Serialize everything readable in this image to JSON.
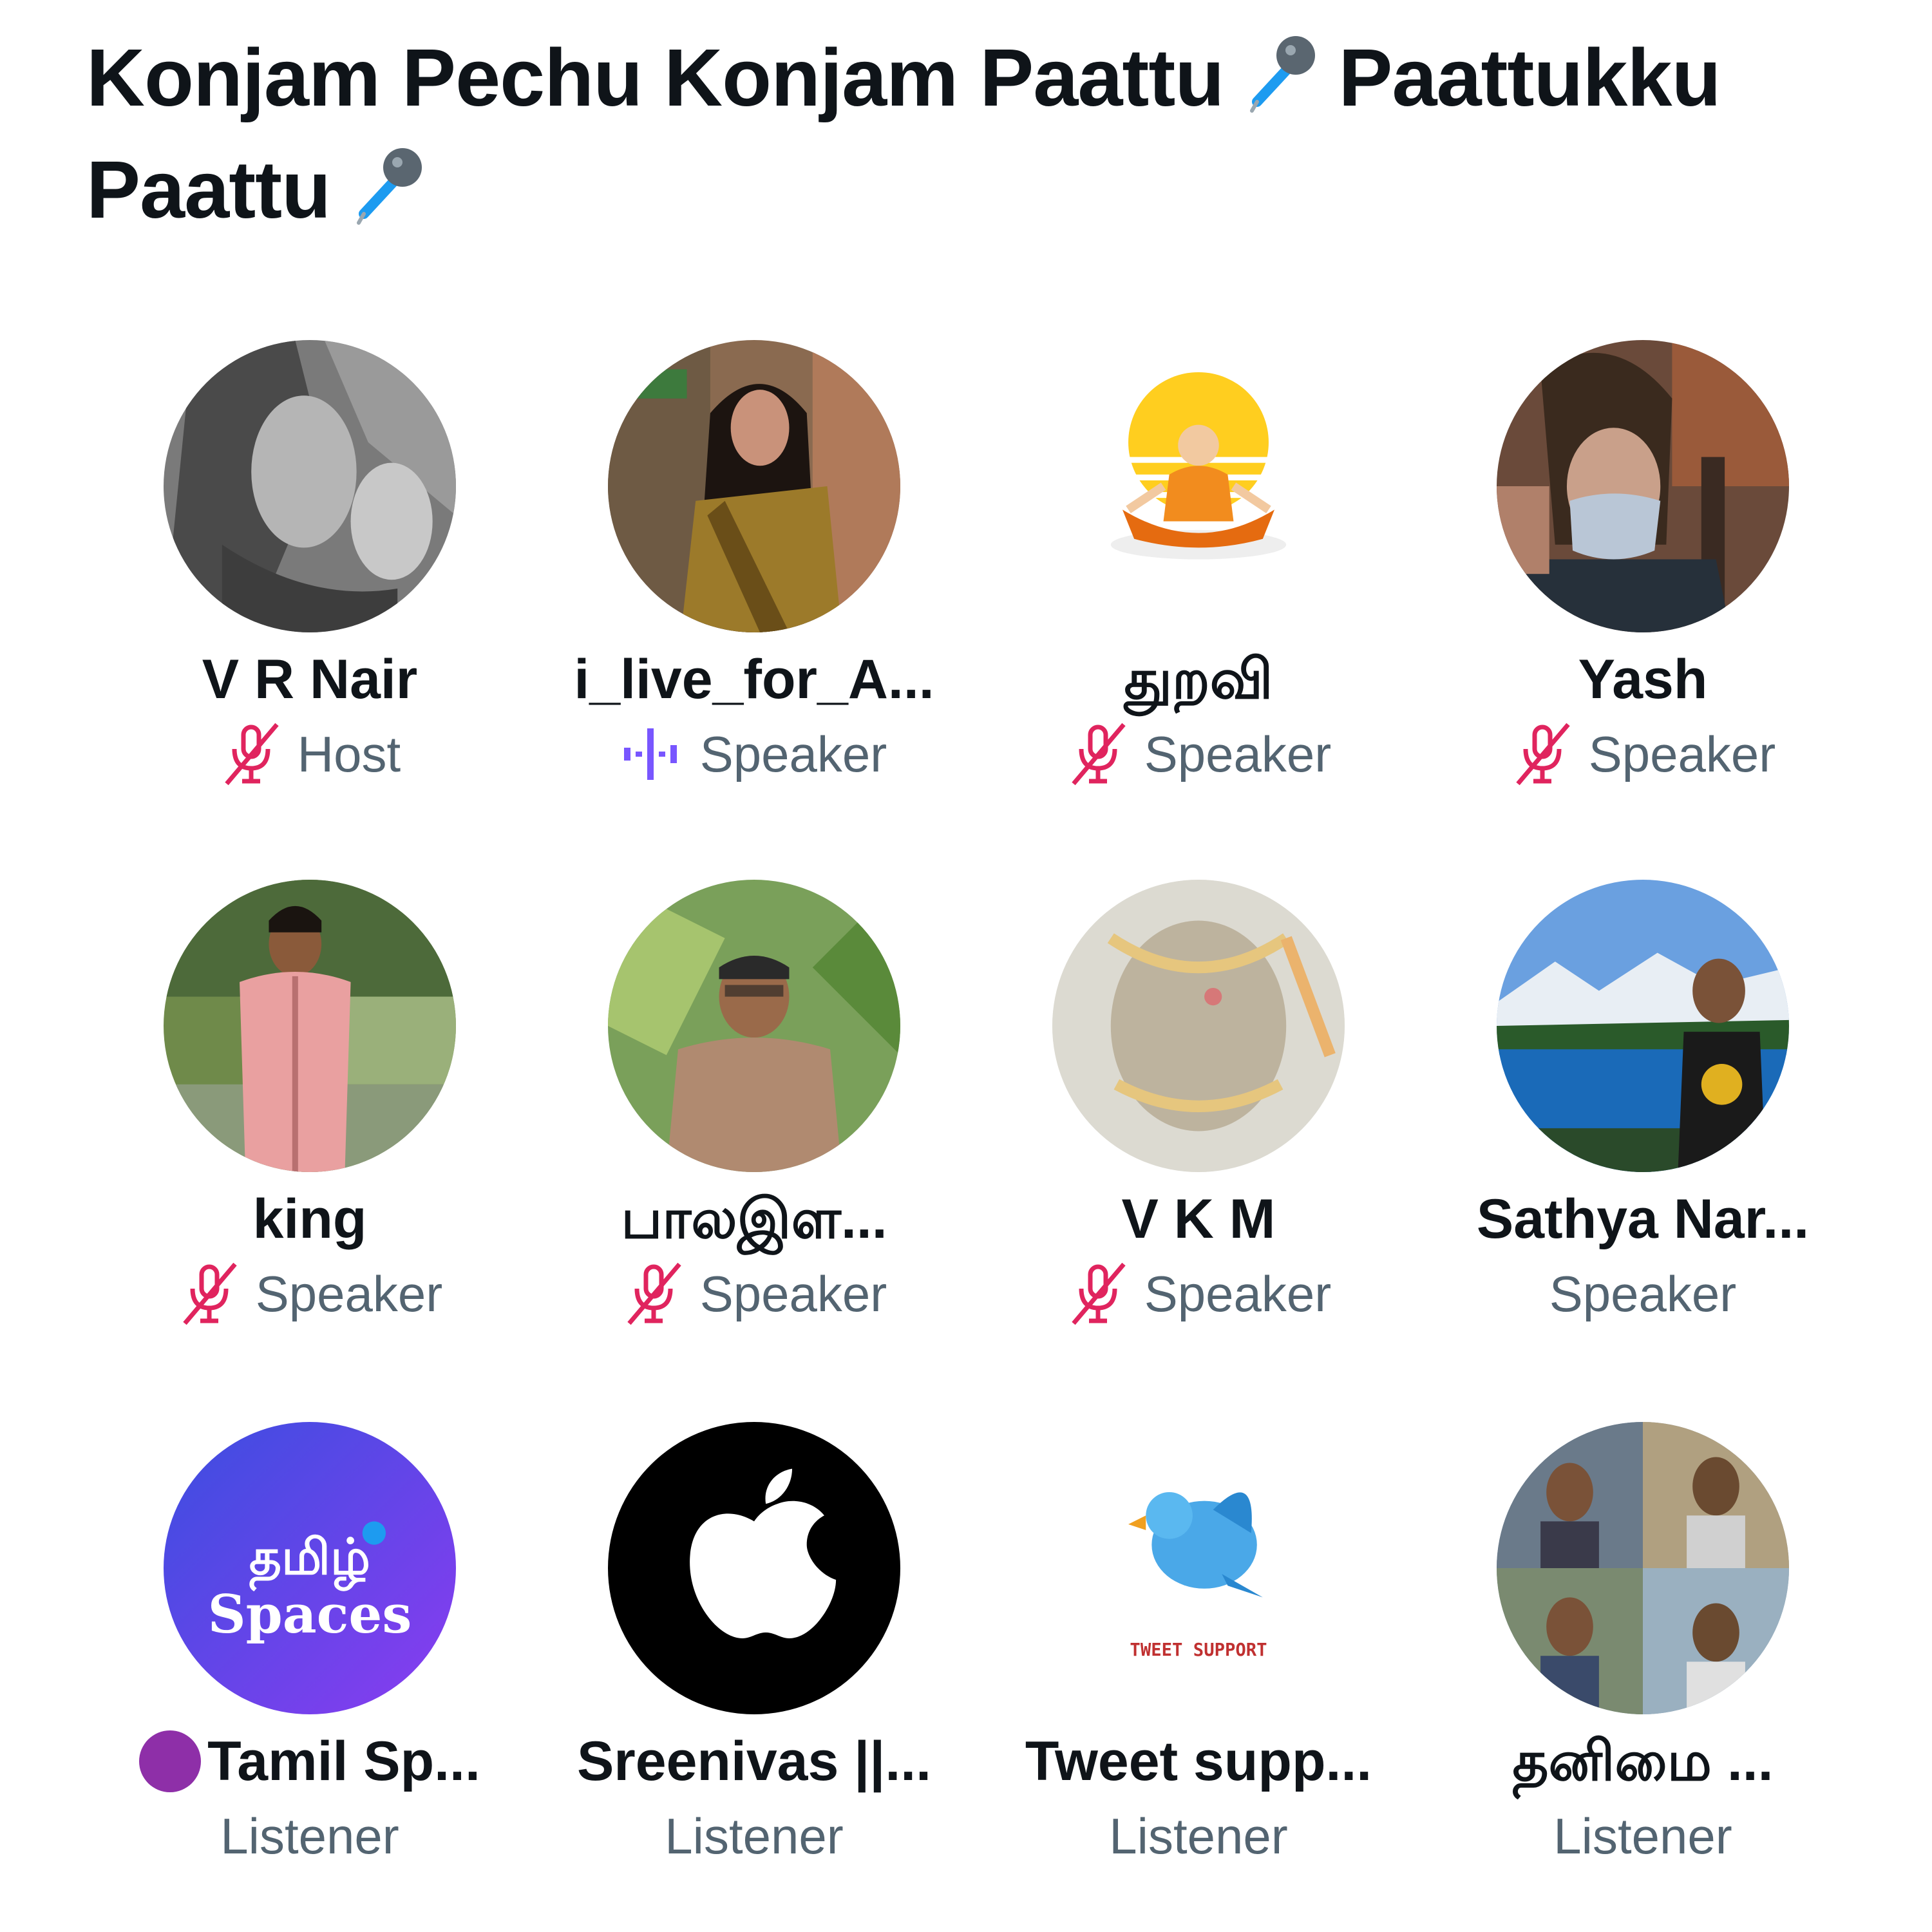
{
  "space": {
    "title_line1": "Konjam Pechu Konjam Paattu",
    "title_line2": "Paattukku",
    "title_line3": "Paattu",
    "title_icon": "microphone-icon"
  },
  "colors": {
    "muted": "#e0245e",
    "speaking": "#7856ff",
    "role_text": "#536471",
    "name_text": "#0f1419"
  },
  "participants": [
    {
      "name": "V R Nair",
      "role": "Host",
      "mic": "muted"
    },
    {
      "name": "i_live_for_A...",
      "role": "Speaker",
      "mic": "speaking"
    },
    {
      "name": "துறவி",
      "role": "Speaker",
      "mic": "muted"
    },
    {
      "name": "Yash",
      "role": "Speaker",
      "mic": "muted"
    },
    {
      "name": "king",
      "role": "Speaker",
      "mic": "muted"
    },
    {
      "name": "பாலஇள...",
      "role": "Speaker",
      "mic": "muted"
    },
    {
      "name": "V K M",
      "role": "Speaker",
      "mic": "muted"
    },
    {
      "name": "Sathya Nar...",
      "role": "Speaker",
      "mic": "none"
    },
    {
      "name": "Tamil Sp...",
      "role": "Listener",
      "mic": "none",
      "prefix": "purple-circle"
    },
    {
      "name": "Sreenivas ||...",
      "role": "Listener",
      "mic": "none"
    },
    {
      "name": "Tweet supp...",
      "role": "Listener",
      "mic": "none"
    },
    {
      "name": "தனிமை ...",
      "role": "Listener",
      "mic": "none"
    }
  ],
  "avatar_texts": {
    "tamil_spaces_line1": "தமிழ்",
    "tamil_spaces_line2": "Spaces",
    "tweet_support": "TWEET SUPPORT"
  }
}
